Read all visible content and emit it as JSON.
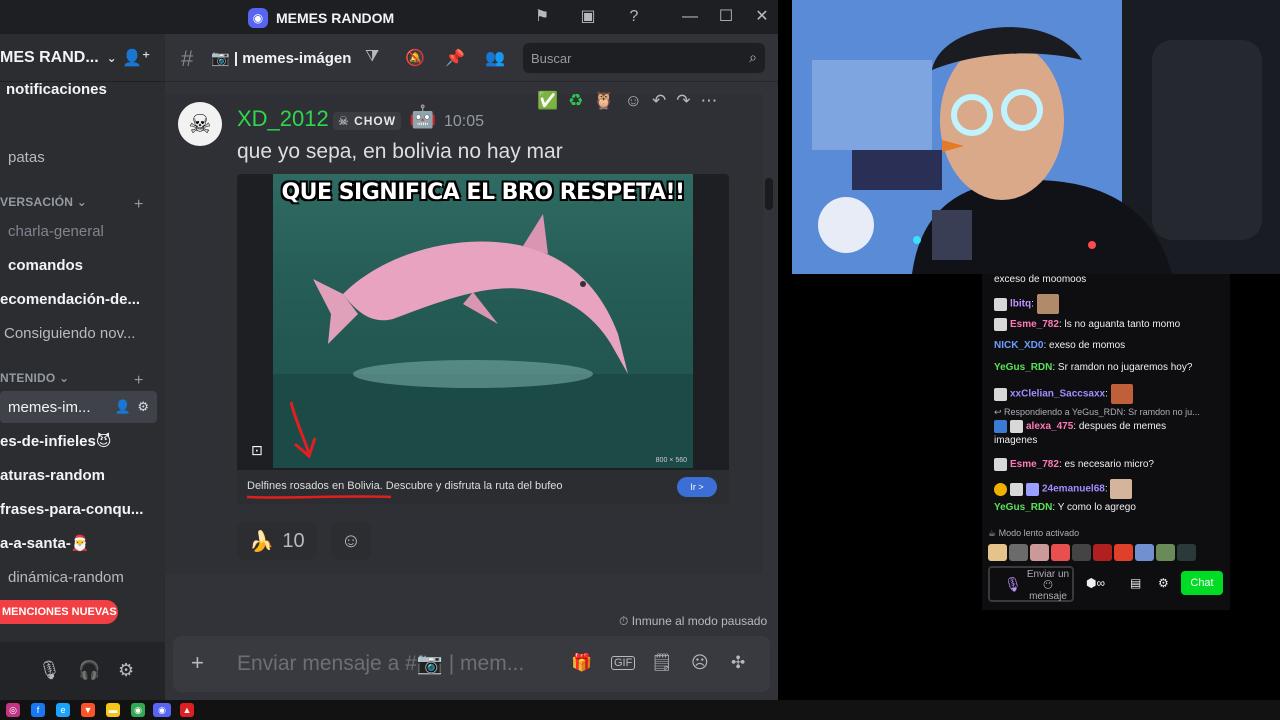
{
  "window": {
    "title": "MEMES RANDOM",
    "icons": [
      "inbox-flag-icon",
      "inbox-icon",
      "help-icon",
      "minimize-icon",
      "maximize-icon",
      "close-icon"
    ]
  },
  "sidebar": {
    "server_name": "MES RAND...",
    "items": [
      {
        "label": "notificaciones",
        "style": "bright"
      },
      {
        "label": "patas",
        "style": "mid"
      },
      {
        "label": "charla-general",
        "style": "muted"
      },
      {
        "label": "comandos",
        "style": "bright"
      },
      {
        "label": "ecomendación-de...",
        "style": "bright"
      },
      {
        "label": "Consiguiendo nov...",
        "style": "mid"
      },
      {
        "label": "memes-im...",
        "style": "active"
      },
      {
        "label": "es-de-infieles😈",
        "style": "bright"
      },
      {
        "label": "aturas-random",
        "style": "bright"
      },
      {
        "label": "frases-para-conqu...",
        "style": "bright"
      },
      {
        "label": "a-a-santa-🎅",
        "style": "bright"
      },
      {
        "label": "dinámica-random",
        "style": "mid"
      }
    ],
    "categories": [
      "VERSACIÓN",
      "NTENIDO"
    ],
    "mentions_label": "MENCIONES NUEVAS"
  },
  "channel": {
    "name": "memes-imágen",
    "search_placeholder": "Buscar"
  },
  "message": {
    "author": "XD_2012",
    "clan_tag": "CHOW",
    "timestamp": "10:05",
    "text": "que yo sepa, en bolivia no hay mar",
    "meme_caption": "QUE SIGNIFICA EL BRO RESPETA!!",
    "meme_dims": "800 × 560",
    "embed_ad": "Delfines rosados en Bolivia. Descubre y disfruta la ruta del bufeo",
    "embed_button": "Ir >",
    "reaction_emoji": "🍌",
    "reaction_count": "10"
  },
  "immune_text": "Inmune al modo pausado",
  "composer": {
    "placeholder": "Enviar mensaje a #📷 | mem..."
  },
  "twitch_chat": {
    "lines": [
      {
        "user": "",
        "text": "exceso de moomoos",
        "user_color": "#efeff1"
      },
      {
        "user": "lbitq",
        "text": ":",
        "user_color": "#bf94ff"
      },
      {
        "user": "Esme_782",
        "text": ": ls no aguanta tanto momo",
        "user_color": "#ff7ab8"
      },
      {
        "user": "NICK_XD0",
        "text": ": exeso de momos",
        "user_color": "#6e9dff"
      },
      {
        "user": "YeGus_RDN",
        "text": ": Sr ramdon no jugaremos hoy?",
        "user_color": "#5ae05a"
      },
      {
        "user": "xxClelian_Saccsaxx",
        "text": ":",
        "user_color": "#a48bff"
      },
      {
        "user": "alexa_475",
        "text": ": despues de memes",
        "user_color": "#ff7ab8"
      },
      {
        "user": "",
        "text": "imagenes",
        "user_color": "#efeff1"
      },
      {
        "user": "Esme_782",
        "text": ": es necesario micro?",
        "user_color": "#ff7ab8"
      },
      {
        "user": "24emanuel68",
        "text": ":",
        "user_color": "#a48bff"
      },
      {
        "user": "YeGus_RDN",
        "text": ": Y como lo agrego",
        "user_color": "#5ae05a"
      }
    ],
    "reply_text": "↩ Respondiendo a YeGus_RDN: Sr ramdon no ju...",
    "slow_mode": "Modo lento activado",
    "input_placeholder": "Enviar un 😶 mensaje",
    "chat_button": "Chat"
  }
}
